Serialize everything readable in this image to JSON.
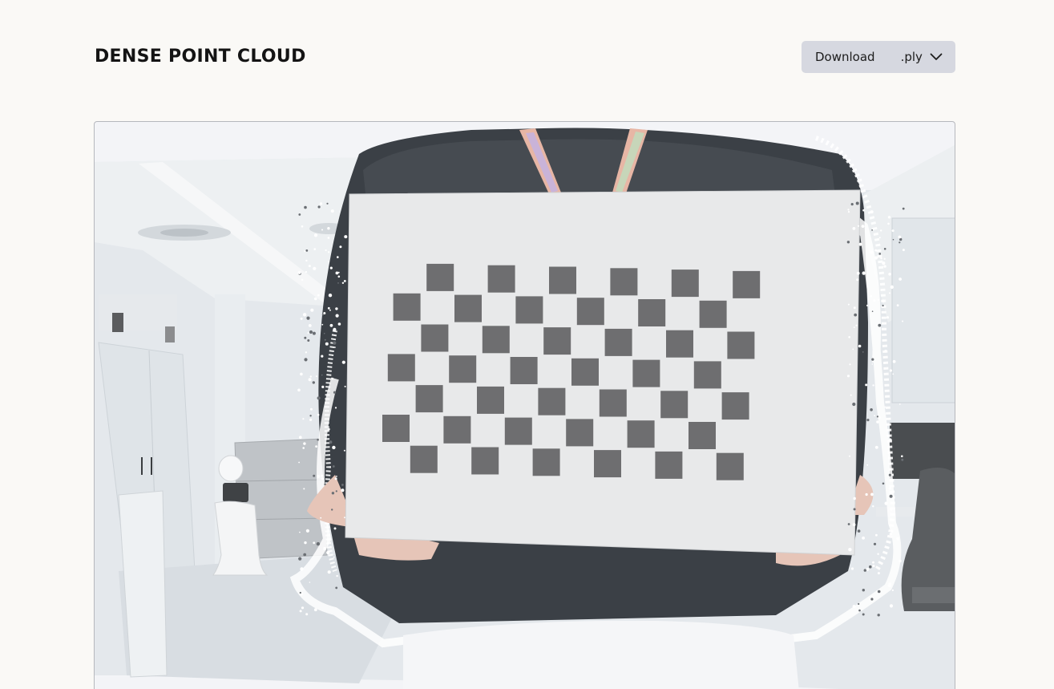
{
  "header": {
    "title": "DENSE POINT CLOUD"
  },
  "download": {
    "label": "Download",
    "format": ".ply",
    "icon": "chevron-down-icon"
  },
  "viewer": {
    "background": "#f3f4f7",
    "checkerboard": {
      "rows": 7,
      "cols": 12,
      "square_color": "#6e6e70"
    }
  }
}
